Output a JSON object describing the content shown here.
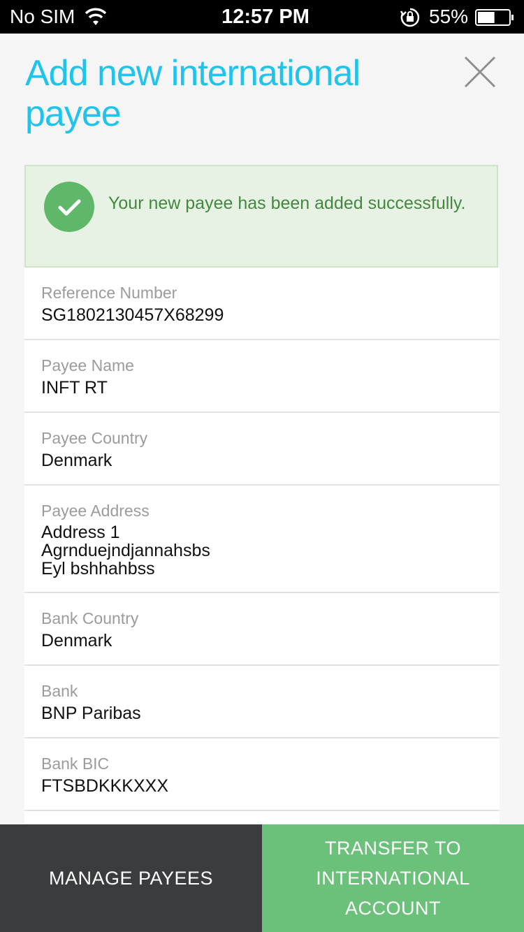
{
  "status_bar": {
    "carrier": "No SIM",
    "time": "12:57 PM",
    "battery_percent": "55%",
    "battery_level": 0.55,
    "icons": [
      "wifi-icon",
      "orientation-lock-icon",
      "battery-icon"
    ]
  },
  "header": {
    "title": "Add new international payee",
    "close_icon": "close-icon"
  },
  "banner": {
    "message": "Your new payee has been added successfully.",
    "icon": "check-circle-icon",
    "color": "#43883f"
  },
  "details": [
    {
      "label": "Reference Number",
      "value": "SG1802130457X68299"
    },
    {
      "label": "Payee Name",
      "value": "INFT RT"
    },
    {
      "label": "Payee Country",
      "value": "Denmark"
    },
    {
      "label": "Payee Address",
      "value": "Address 1\nAgrnduejndjannahsbs\nEyl bshhahbss"
    },
    {
      "label": "Bank Country",
      "value": "Denmark"
    },
    {
      "label": "Bank",
      "value": "BNP Paribas"
    },
    {
      "label": "Bank BIC",
      "value": "FTSBDKKKXXX"
    }
  ],
  "actions": {
    "manage_label": "MANAGE PAYEES",
    "transfer_label": "TRANSFER TO\nINTERNATIONAL\nACCOUNT"
  },
  "colors": {
    "accent": "#1fc3ec",
    "success_bg": "#e7f2e4",
    "manage_bg": "#3b3c3e",
    "transfer_bg": "#6bc07a"
  }
}
